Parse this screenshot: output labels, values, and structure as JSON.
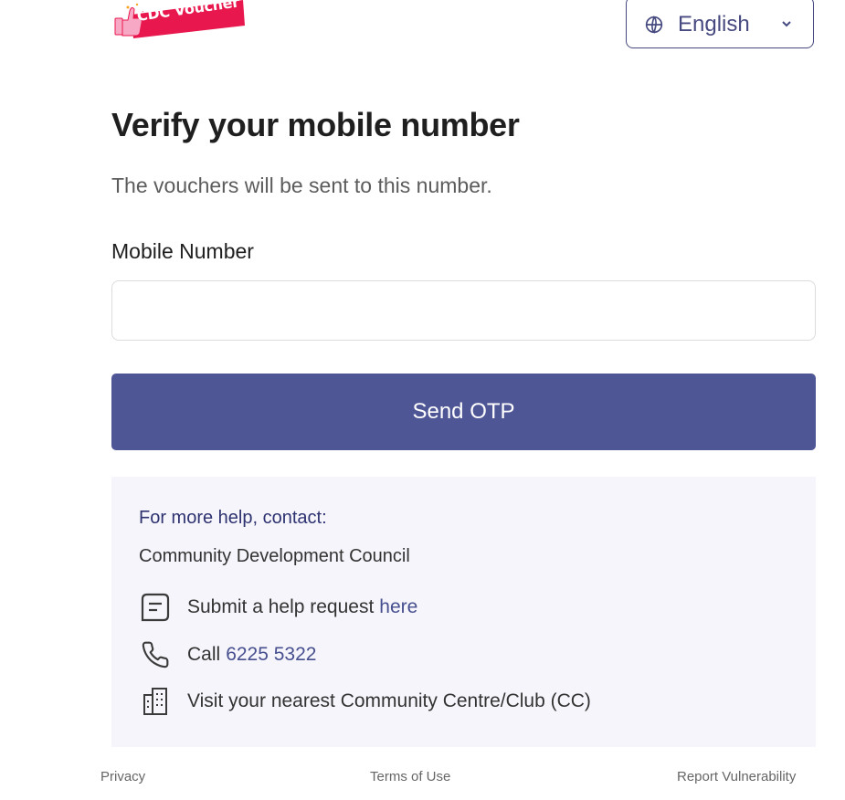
{
  "logo": {
    "text": "CDC Voucher"
  },
  "language": {
    "selected": "English"
  },
  "title": "Verify your mobile number",
  "subtitle": "The vouchers will be sent to this number.",
  "mobile_field": {
    "label": "Mobile Number",
    "value": "",
    "placeholder": ""
  },
  "send_button": {
    "label": "Send OTP"
  },
  "help": {
    "heading": "For more help, contact:",
    "organization": "Community Development Council",
    "request": {
      "text": "Submit a help request",
      "link": "here",
      "icon": "message-square-icon"
    },
    "call": {
      "text": "Call",
      "number": "6225 5322",
      "icon": "phone-icon"
    },
    "visit": {
      "text": "Visit your nearest Community Centre/Club (CC)",
      "icon": "building-icon"
    }
  },
  "footer": {
    "privacy": "Privacy",
    "terms": "Terms of Use",
    "report": "Report Vulnerability"
  },
  "colors": {
    "primary": "#4f5696",
    "logo_red": "#e8174d",
    "help_bg": "#f5f5fb"
  }
}
